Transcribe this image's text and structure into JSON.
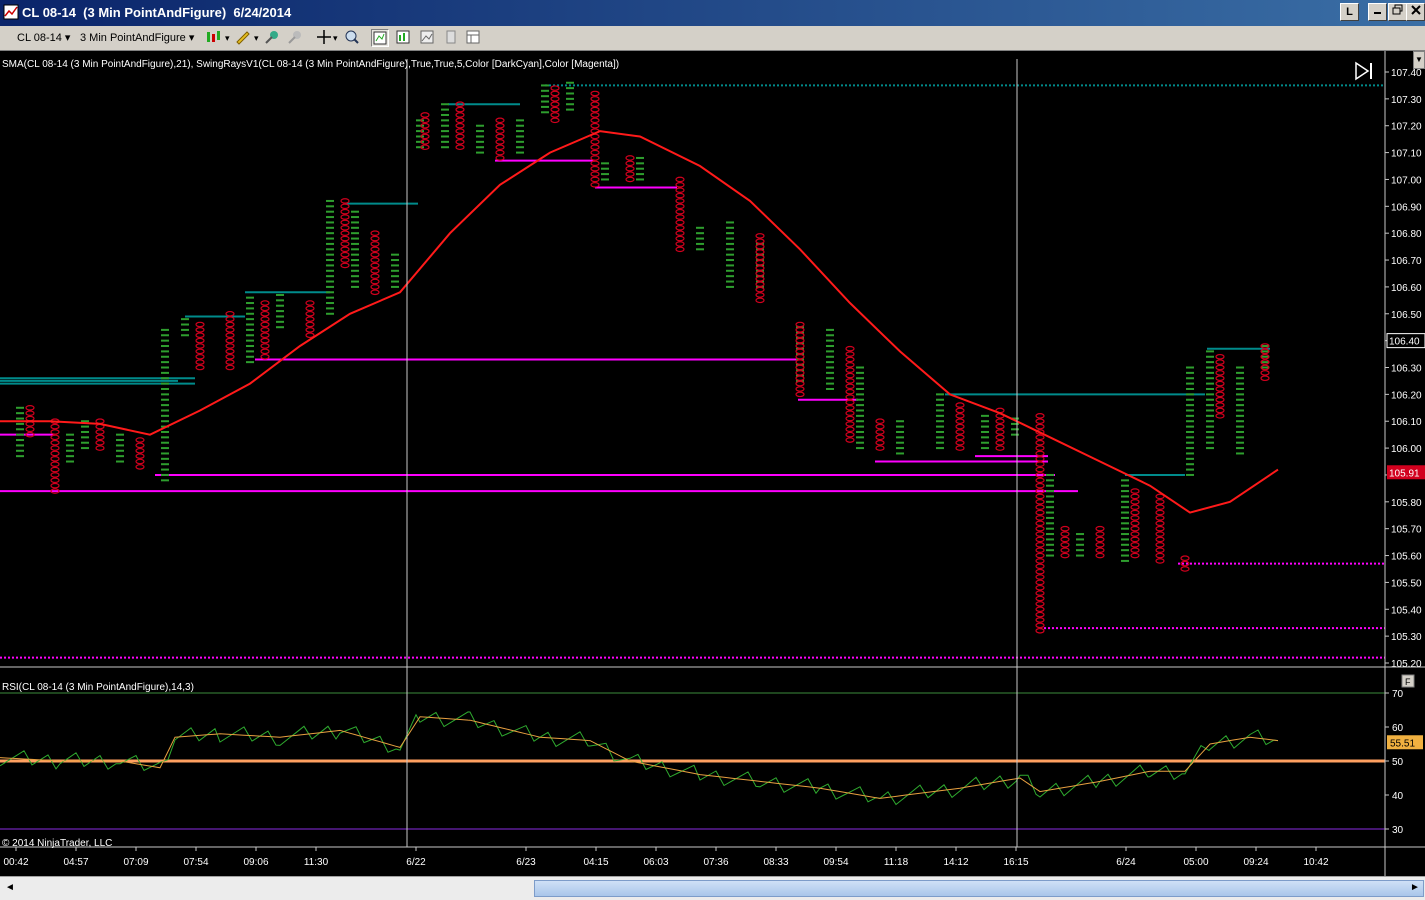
{
  "window": {
    "title": "CL 08-14  (3 Min PointAndFigure)  6/24/2014",
    "link_button": "L",
    "minimize_icon": "minimize-icon",
    "restore_icon": "restore-icon",
    "close_icon": "close-icon"
  },
  "toolbar": {
    "instrument": "CL 08-14",
    "period": "3 Min PointAndFigure",
    "icons": [
      "bar-style-icon",
      "draw-pencil-icon",
      "crosshair-icon",
      "zoom-icon",
      "chart-properties-icon",
      "indicators-icon",
      "strategies-icon",
      "data-box-icon",
      "templates-icon"
    ]
  },
  "price_panel": {
    "indicator_label": "SMA(CL 08-14 (3 Min PointAndFigure),21), SwingRaysV1(CL 08-14 (3 Min PointAndFigure),True,True,5,Color [DarkCyan],Color [Magenta])",
    "axis_labels": [
      "107.40",
      "107.30",
      "107.20",
      "107.10",
      "107.00",
      "106.90",
      "106.80",
      "106.70",
      "106.60",
      "106.50",
      "106.40",
      "106.30",
      "106.20",
      "106.10",
      "106.00",
      "105.90",
      "105.80",
      "105.70",
      "105.60",
      "105.50",
      "105.40",
      "105.30",
      "105.20"
    ],
    "last_price_label": "105.91",
    "highlight_label": "106.40",
    "ylim": [
      105.2,
      107.4
    ],
    "colors": {
      "x_box": "#2e9e2e",
      "o_box": "#d2001e",
      "sma": "#ff1a1a",
      "swing_high": "#008b8b",
      "swing_low": "#ff00ff",
      "last_price_bg": "#d2001e"
    }
  },
  "rsi_panel": {
    "indicator_label": "RSI(CL 08-14 (3 Min PointAndFigure),14,3)",
    "axis_labels": [
      "70",
      "60",
      "50",
      "40",
      "30"
    ],
    "value_label": "55.51",
    "ylim": [
      30,
      70
    ],
    "line_50_color": "#ffa060"
  },
  "time_axis": {
    "labels": [
      "00:42",
      "04:57",
      "07:09",
      "07:54",
      "09:06",
      "11:30",
      "6/22",
      "6/23",
      "04:15",
      "06:03",
      "07:36",
      "08:33",
      "09:54",
      "11:18",
      "14:12",
      "16:15",
      "6/24",
      "05:00",
      "09:24",
      "10:42"
    ]
  },
  "copyright": "© 2014 NinjaTrader, LLC",
  "f_button": "F",
  "scrollbar": {
    "left_arrow": "◄",
    "right_arrow": "►"
  },
  "chart_data": {
    "type": "line",
    "title": "CL 08-14 (3 Min PointAndFigure)",
    "sma_series": {
      "name": "SMA(21)",
      "points": [
        [
          0,
          106.1
        ],
        [
          50,
          106.1
        ],
        [
          100,
          106.09
        ],
        [
          150,
          106.05
        ],
        [
          200,
          106.14
        ],
        [
          250,
          106.24
        ],
        [
          300,
          106.38
        ],
        [
          350,
          106.5
        ],
        [
          400,
          106.58
        ],
        [
          450,
          106.8
        ],
        [
          500,
          106.98
        ],
        [
          550,
          107.1
        ],
        [
          600,
          107.18
        ],
        [
          640,
          107.16
        ],
        [
          700,
          107.05
        ],
        [
          750,
          106.92
        ],
        [
          800,
          106.74
        ],
        [
          850,
          106.54
        ],
        [
          900,
          106.36
        ],
        [
          950,
          106.2
        ],
        [
          1000,
          106.13
        ],
        [
          1050,
          106.04
        ],
        [
          1100,
          105.95
        ],
        [
          1150,
          105.86
        ],
        [
          1190,
          105.76
        ],
        [
          1230,
          105.8
        ],
        [
          1278,
          105.92
        ]
      ]
    },
    "rsi_series": {
      "name": "RSI(14,3)",
      "points": [
        [
          0,
          51
        ],
        [
          60,
          50
        ],
        [
          120,
          50
        ],
        [
          160,
          48
        ],
        [
          175,
          57
        ],
        [
          220,
          58
        ],
        [
          280,
          57
        ],
        [
          340,
          59
        ],
        [
          400,
          54
        ],
        [
          420,
          63
        ],
        [
          470,
          62
        ],
        [
          540,
          57
        ],
        [
          590,
          56
        ],
        [
          630,
          50
        ],
        [
          700,
          46
        ],
        [
          760,
          44
        ],
        [
          820,
          42
        ],
        [
          880,
          39
        ],
        [
          960,
          42
        ],
        [
          1020,
          45
        ],
        [
          1040,
          41
        ],
        [
          1100,
          44
        ],
        [
          1150,
          47
        ],
        [
          1185,
          47
        ],
        [
          1210,
          55
        ],
        [
          1250,
          57
        ],
        [
          1278,
          56
        ]
      ]
    },
    "x_columns": [
      [
        20,
        105.97,
        106.15
      ],
      [
        70,
        105.95,
        106.05
      ],
      [
        85,
        106.0,
        106.1
      ],
      [
        120,
        105.95,
        106.05
      ],
      [
        165,
        105.88,
        106.44
      ],
      [
        185,
        106.42,
        106.49
      ],
      [
        250,
        106.32,
        106.57
      ],
      [
        280,
        106.45,
        106.57
      ],
      [
        330,
        106.5,
        106.93
      ],
      [
        355,
        106.6,
        106.88
      ],
      [
        395,
        106.6,
        106.72
      ],
      [
        420,
        107.12,
        107.22
      ],
      [
        445,
        107.12,
        107.28
      ],
      [
        480,
        107.1,
        107.2
      ],
      [
        520,
        107.1,
        107.22
      ],
      [
        545,
        107.25,
        107.36
      ],
      [
        570,
        107.26,
        107.36
      ],
      [
        605,
        107.0,
        107.07
      ],
      [
        640,
        107.0,
        107.08
      ],
      [
        700,
        106.74,
        106.82
      ],
      [
        730,
        106.6,
        106.85
      ],
      [
        760,
        106.6,
        106.76
      ],
      [
        800,
        106.25,
        106.45
      ],
      [
        830,
        106.22,
        106.44
      ],
      [
        860,
        106.0,
        106.3
      ],
      [
        900,
        105.98,
        106.1
      ],
      [
        940,
        106.0,
        106.2
      ],
      [
        985,
        106.0,
        106.12
      ],
      [
        1015,
        106.05,
        106.12
      ],
      [
        1050,
        105.6,
        105.9
      ],
      [
        1080,
        105.6,
        105.69
      ],
      [
        1125,
        105.58,
        105.89
      ],
      [
        1190,
        105.9,
        106.3
      ],
      [
        1210,
        106.0,
        106.37
      ],
      [
        1240,
        105.98,
        106.3
      ],
      [
        1265,
        106.3,
        106.39
      ]
    ],
    "o_columns": [
      [
        30,
        106.05,
        106.16
      ],
      [
        55,
        105.84,
        106.1
      ],
      [
        100,
        106.0,
        106.1
      ],
      [
        140,
        105.93,
        106.03
      ],
      [
        200,
        106.3,
        106.46
      ],
      [
        230,
        106.3,
        106.5
      ],
      [
        265,
        106.34,
        106.55
      ],
      [
        310,
        106.42,
        106.55
      ],
      [
        345,
        106.68,
        106.92
      ],
      [
        375,
        106.58,
        106.8
      ],
      [
        425,
        107.12,
        107.24
      ],
      [
        460,
        107.12,
        107.28
      ],
      [
        500,
        107.08,
        107.22
      ],
      [
        555,
        107.22,
        107.34
      ],
      [
        595,
        106.98,
        107.32
      ],
      [
        630,
        107.0,
        107.08
      ],
      [
        680,
        106.74,
        107.0
      ],
      [
        760,
        106.55,
        106.8
      ],
      [
        800,
        106.2,
        106.46
      ],
      [
        850,
        106.03,
        106.38
      ],
      [
        880,
        106.0,
        106.1
      ],
      [
        960,
        106.0,
        106.16
      ],
      [
        1000,
        106.0,
        106.14
      ],
      [
        1040,
        105.32,
        106.12
      ],
      [
        1065,
        105.6,
        105.7
      ],
      [
        1100,
        105.6,
        105.7
      ],
      [
        1135,
        105.6,
        105.85
      ],
      [
        1160,
        105.58,
        105.83
      ],
      [
        1185,
        105.55,
        105.6
      ],
      [
        1220,
        106.12,
        106.34
      ],
      [
        1265,
        106.26,
        106.39
      ]
    ],
    "swing_high_rays": [
      [
        0,
        195,
        106.26
      ],
      [
        0,
        178,
        106.25
      ],
      [
        0,
        195,
        106.24
      ],
      [
        185,
        245,
        106.49
      ],
      [
        245,
        330,
        106.58
      ],
      [
        345,
        418,
        106.91
      ],
      [
        448,
        520,
        107.28
      ],
      [
        545,
        1385,
        107.35
      ],
      [
        945,
        1205,
        106.2
      ],
      [
        1125,
        1185,
        105.9
      ],
      [
        1207,
        1270,
        106.37
      ]
    ],
    "swing_low_rays": [
      [
        0,
        55,
        106.05
      ],
      [
        155,
        1055,
        105.9
      ],
      [
        0,
        1078,
        105.84
      ],
      [
        255,
        798,
        106.33
      ],
      [
        495,
        595,
        107.07
      ],
      [
        595,
        677,
        106.97
      ],
      [
        798,
        858,
        106.18
      ],
      [
        875,
        1048,
        105.95
      ],
      [
        975,
        1048,
        105.97
      ],
      [
        1178,
        1385,
        105.57
      ],
      [
        1040,
        1385,
        105.33
      ],
      [
        0,
        1385,
        105.22
      ]
    ]
  }
}
